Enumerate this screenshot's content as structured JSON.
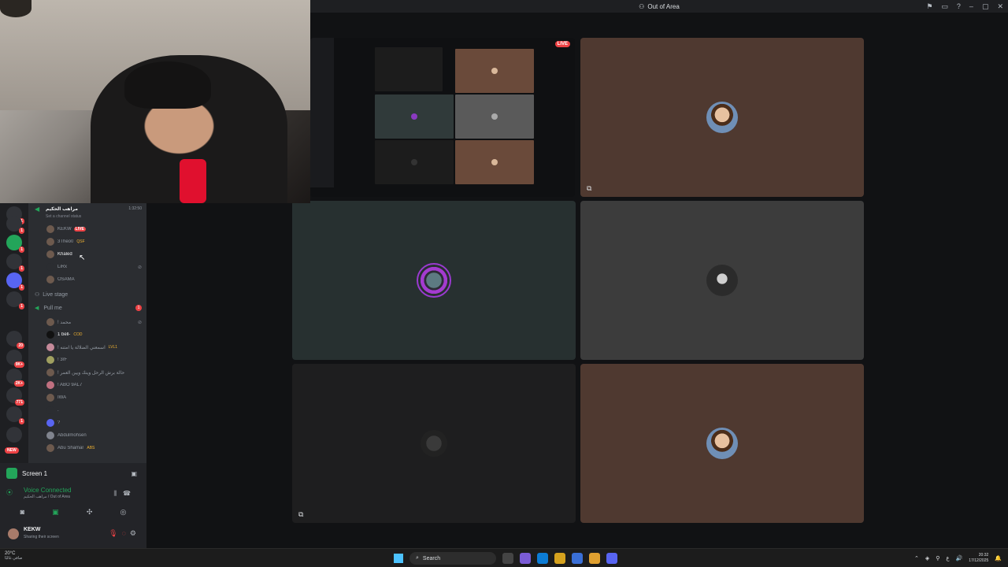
{
  "window": {
    "title": "Out of Area",
    "controls": [
      "⚑",
      "▭",
      "?",
      "–",
      "▢",
      "✕"
    ]
  },
  "stage": {
    "share_live_label": "LIVE"
  },
  "channel": {
    "name": "مراهب الحكيم",
    "time": "1:32:50",
    "status": "Set a channel status",
    "members": [
      {
        "name": "KEKW",
        "live": "LIVE"
      },
      {
        "name": "3Theo0",
        "tag": "QSF"
      },
      {
        "name": "Khaled"
      },
      {
        "name": "LiRx"
      },
      {
        "name": "OSAMA"
      }
    ],
    "live_stage": "Live stage",
    "pull_me": "Pull me",
    "pull_count": "1",
    "pull_members": [
      {
        "name": "! محمد"
      },
      {
        "name": "1 bell-",
        "tag": "COD"
      },
      {
        "name": "! اسمعني الضلالة يا امتنه",
        "tag": "LVL1"
      },
      {
        "name": "! 3rF"
      },
      {
        "name": "! حالة برش الرحل وينك ويين العمر"
      },
      {
        "name": "! ABO 9AL7"
      },
      {
        "name": "IWA"
      },
      {
        "name": "."
      },
      {
        "name": "?"
      },
      {
        "name": "Abdulmohsen"
      },
      {
        "name": "Abu Shamar",
        "tag": "ABS"
      }
    ]
  },
  "server_badges": [
    "1",
    "1",
    "1",
    "1",
    "1",
    "1",
    "20",
    "9K+",
    "2K+",
    "771",
    "1"
  ],
  "new_badge": "NEW",
  "screen_share": {
    "label": "Screen 1",
    "voice_status": "Voice Connected",
    "voice_location": "مراهب الحكيم / Out of Area"
  },
  "user": {
    "name": "KEKW",
    "status": "Sharing their screen"
  },
  "taskbar": {
    "temp": "20°C",
    "weather": "صافي غالبًا",
    "search": "Search",
    "time": "20:32",
    "date": "17/12/2025",
    "lang": "ع"
  },
  "colors": {
    "live": "#ed4245",
    "online": "#23a55a",
    "tile_brown": "#4f3930"
  }
}
